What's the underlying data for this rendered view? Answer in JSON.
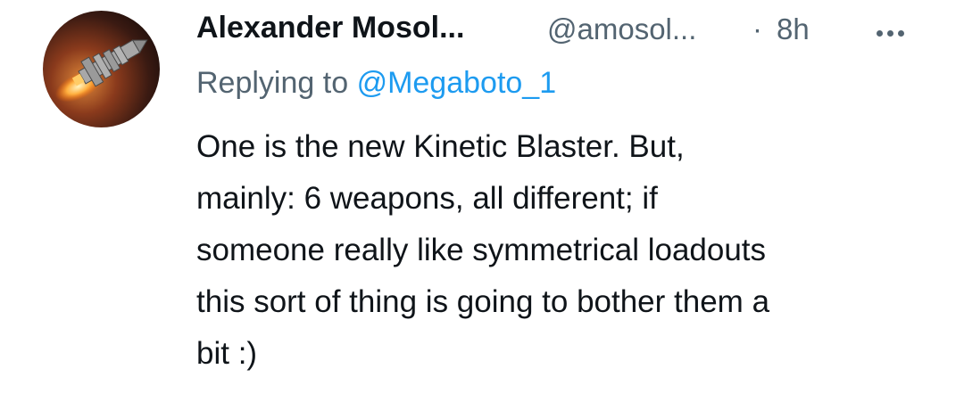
{
  "tweet": {
    "author_name": "Alexander Mosol...",
    "handle": "@amosol...",
    "separator": "·",
    "timestamp": "8h",
    "replying_prefix": "Replying to",
    "replying_to": "@Megaboto_1",
    "text_lines": [
      "One is the new Kinetic Blaster. But,",
      "mainly: 6 weapons, all different; if",
      "someone really like symmetrical loadouts",
      "this sort of thing is going to bother them a",
      "bit :)"
    ],
    "more_icon": "more-horizontal-icon"
  },
  "colors": {
    "text": "#0f1419",
    "secondary": "#536471",
    "link": "#1d9bf0"
  }
}
